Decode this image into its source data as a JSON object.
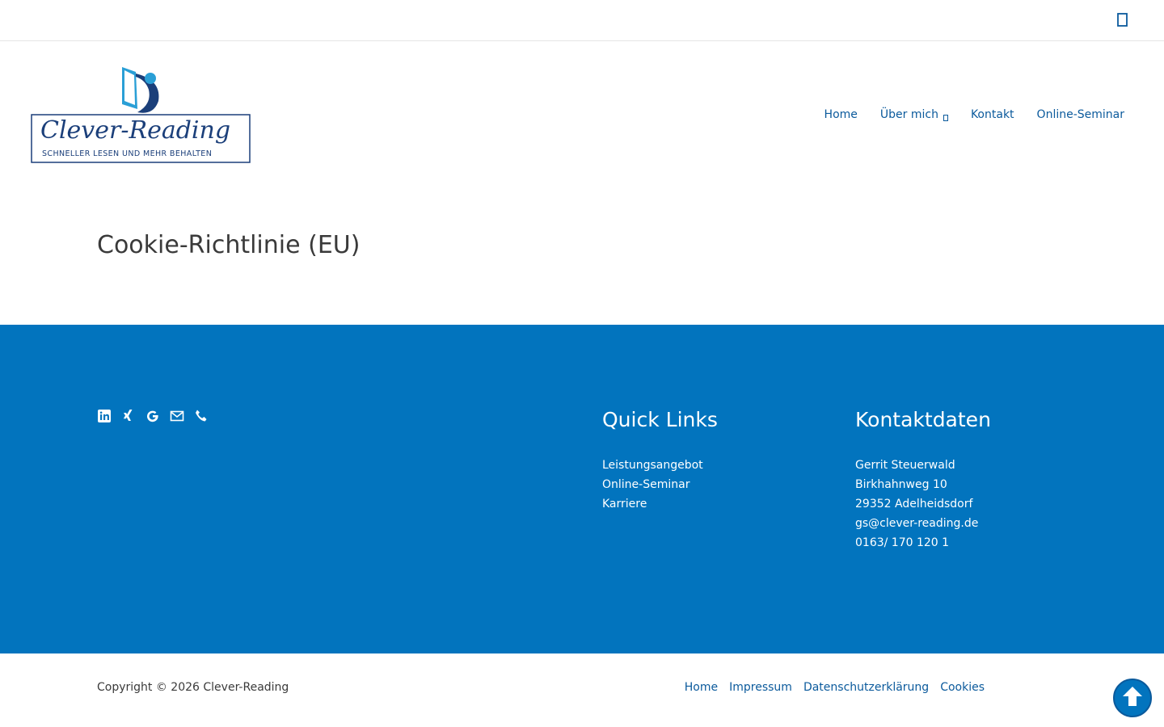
{
  "header": {
    "logo_text": "Clever-Reading",
    "logo_tagline": "SCHNELLER LESEN UND MEHR BEHALTEN",
    "nav": [
      {
        "label": "Home"
      },
      {
        "label": "Über mich"
      },
      {
        "label": "Kontakt"
      },
      {
        "label": "Online-Seminar"
      }
    ]
  },
  "page": {
    "title": "Cookie-Richtlinie (EU)"
  },
  "footer": {
    "social_icons": [
      "linkedin-icon",
      "xing-icon",
      "google-icon",
      "mail-icon",
      "phone-icon"
    ],
    "quick_links": {
      "heading": "Quick Links",
      "items": [
        "Leistungsangebot",
        "Online-Seminar",
        "Karriere"
      ]
    },
    "contact": {
      "heading": "Kontaktdaten",
      "lines": [
        "Gerrit Steuerwald",
        "Birkhahnweg 10",
        "29352 Adelheidsdorf",
        "gs@clever-reading.de",
        "0163/ 170 120 1"
      ]
    },
    "copyright": "Copyright © 2026 Clever-Reading",
    "bottom_nav": [
      "Home",
      "Impressum",
      "Datenschutzerklärung",
      "Cookies"
    ]
  },
  "colors": {
    "brand_blue": "#0274be",
    "link_blue": "#0b5a9c",
    "logo_navy": "#1b3f7a"
  }
}
